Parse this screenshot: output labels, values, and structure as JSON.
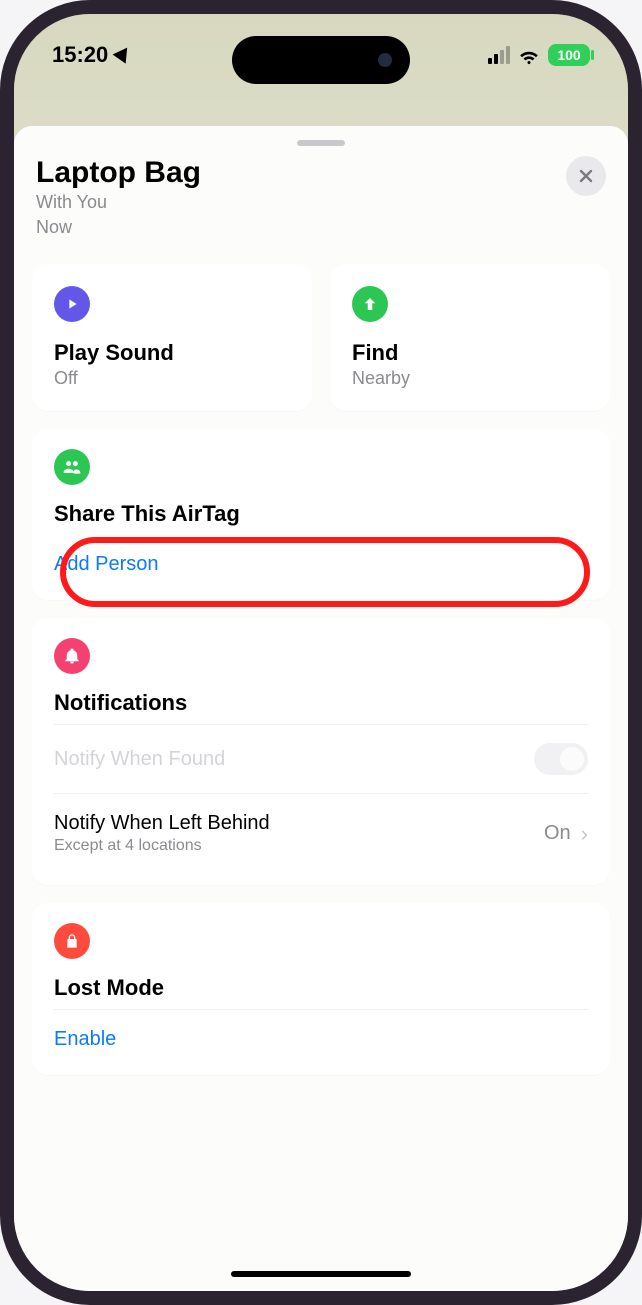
{
  "status": {
    "time": "15:20",
    "battery_pct": "100"
  },
  "sheet": {
    "item_name": "Laptop Bag",
    "location_status": "With You",
    "time_status": "Now"
  },
  "tiles": {
    "play": {
      "title": "Play Sound",
      "sub": "Off"
    },
    "find": {
      "title": "Find",
      "sub": "Nearby"
    }
  },
  "share": {
    "title": "Share This AirTag",
    "add_person": "Add Person"
  },
  "notifications": {
    "title": "Notifications",
    "notify_found": "Notify When Found",
    "notify_left": {
      "title": "Notify When Left Behind",
      "sub": "Except at 4 locations",
      "value": "On"
    }
  },
  "lost_mode": {
    "title": "Lost Mode",
    "enable": "Enable"
  }
}
